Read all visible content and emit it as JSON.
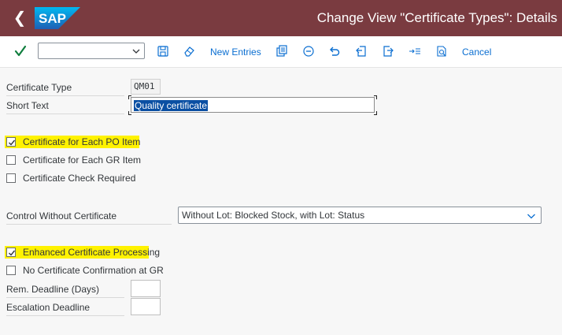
{
  "shell": {
    "title": "Change View \"Certificate Types\": Details",
    "logo_text": "SAP"
  },
  "toolbar": {
    "new_entries_label": "New Entries",
    "cancel_label": "Cancel",
    "command_field_value": ""
  },
  "form": {
    "certificate_type_label": "Certificate Type",
    "certificate_type_value": "QM01",
    "short_text_label": "Short Text",
    "short_text_value": "Quality certificate",
    "checkbox_po_item_label": "Certificate for Each PO Item",
    "checkbox_po_item_checked": true,
    "checkbox_gr_item_label": "Certificate for Each GR Item",
    "checkbox_gr_item_checked": false,
    "checkbox_check_required_label": "Certificate Check Required",
    "checkbox_check_required_checked": false,
    "control_label": "Control Without Certificate",
    "control_value": "Without Lot: Blocked Stock, with Lot: Status",
    "checkbox_enhanced_label": "Enhanced Certificate Processing",
    "checkbox_enhanced_checked": true,
    "checkbox_no_confirm_label": "No Certificate Confirmation at GR",
    "checkbox_no_confirm_checked": false,
    "rem_deadline_label": "Rem. Deadline (Days)",
    "rem_deadline_value": "",
    "escalation_label": "Escalation Deadline",
    "escalation_value": ""
  },
  "colors": {
    "shell_bg": "#7a3b40",
    "link_blue": "#0a6ed1",
    "highlight_yellow": "#fff200",
    "confirm_green": "#107e3e"
  },
  "icons": [
    "back-icon",
    "sap-logo",
    "check-icon",
    "save-icon",
    "eraser-icon",
    "copy-icon",
    "minus-circle-icon",
    "undo-icon",
    "prev-entry-icon",
    "next-entry-icon",
    "select-icon",
    "find-icon",
    "dropdown-caret-icon"
  ]
}
